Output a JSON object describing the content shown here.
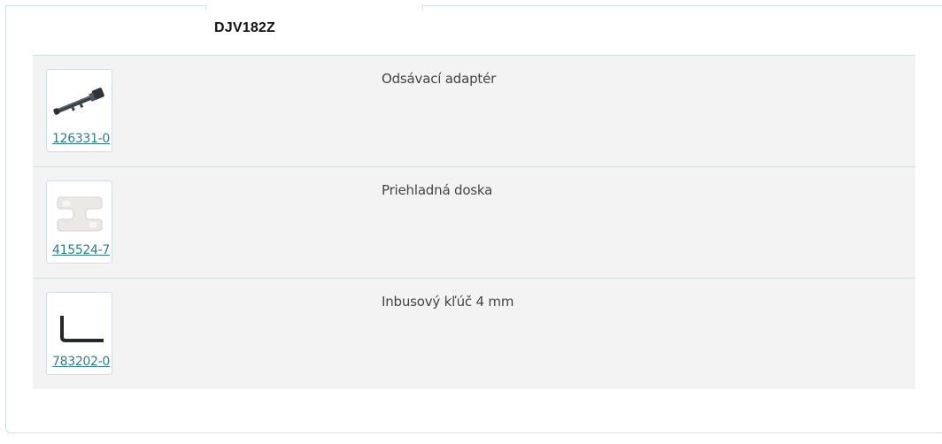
{
  "model": "DJV182Z",
  "parts": [
    {
      "part_number": "126331-0",
      "name": "Odsávací adaptér",
      "icon": "dust-adapter-icon"
    },
    {
      "part_number": "415524-7",
      "name": "Priehladná doska",
      "icon": "transparent-plate-icon"
    },
    {
      "part_number": "783202-0",
      "name": "Inbusový kľúč 4 mm",
      "icon": "hex-key-icon"
    }
  ],
  "colors": {
    "link": "#2c7c8c",
    "row_background": "#f3f3f3",
    "border": "#cfdfe0"
  }
}
